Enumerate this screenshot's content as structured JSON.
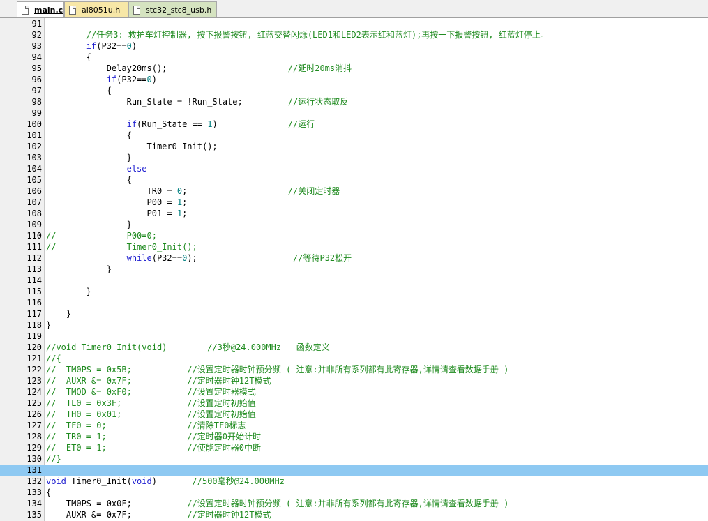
{
  "tabs": [
    {
      "label": "main.c",
      "active": true,
      "color": "#ffffff"
    },
    {
      "label": "ai8051u.h",
      "active": false,
      "color": "#f7e7a7"
    },
    {
      "label": "stc32_stc8_usb.h",
      "active": false,
      "color": "#d5e3c0"
    }
  ],
  "colors": {
    "keyword": "#1f1fd0",
    "number": "#008080",
    "comment": "#1e8a1e",
    "highlight": "#8ec9f2"
  },
  "editor": {
    "highlighted_line": "131",
    "lines": [
      {
        "n": "91",
        "tokens": []
      },
      {
        "n": "92",
        "tokens": [
          {
            "t": "        "
          },
          {
            "t": "//任务3: 救护车灯控制器, 按下报警按钮, 红蓝交替闪烁(LED1和LED2表示红和蓝灯);再按一下报警按钮, 红蓝灯停止。",
            "c": "cm"
          }
        ]
      },
      {
        "n": "93",
        "tokens": [
          {
            "t": "        "
          },
          {
            "t": "if",
            "c": "kw"
          },
          {
            "t": "(P32=="
          },
          {
            "t": "0",
            "c": "num"
          },
          {
            "t": ")"
          }
        ]
      },
      {
        "n": "94",
        "tokens": [
          {
            "t": "        {"
          }
        ]
      },
      {
        "n": "95",
        "tokens": [
          {
            "t": "            Delay20ms();                        "
          },
          {
            "t": "//延时20ms消抖",
            "c": "cm"
          }
        ]
      },
      {
        "n": "96",
        "tokens": [
          {
            "t": "            "
          },
          {
            "t": "if",
            "c": "kw"
          },
          {
            "t": "(P32=="
          },
          {
            "t": "0",
            "c": "num"
          },
          {
            "t": ")"
          }
        ]
      },
      {
        "n": "97",
        "tokens": [
          {
            "t": "            {"
          }
        ]
      },
      {
        "n": "98",
        "tokens": [
          {
            "t": "                Run_State = !Run_State;         "
          },
          {
            "t": "//运行状态取反",
            "c": "cm"
          }
        ]
      },
      {
        "n": "99",
        "tokens": []
      },
      {
        "n": "100",
        "tokens": [
          {
            "t": "                "
          },
          {
            "t": "if",
            "c": "kw"
          },
          {
            "t": "(Run_State == "
          },
          {
            "t": "1",
            "c": "num"
          },
          {
            "t": ")              "
          },
          {
            "t": "//运行",
            "c": "cm"
          }
        ]
      },
      {
        "n": "101",
        "tokens": [
          {
            "t": "                {"
          }
        ]
      },
      {
        "n": "102",
        "tokens": [
          {
            "t": "                    Timer0_Init();"
          }
        ]
      },
      {
        "n": "103",
        "tokens": [
          {
            "t": "                }"
          }
        ]
      },
      {
        "n": "104",
        "tokens": [
          {
            "t": "                "
          },
          {
            "t": "else",
            "c": "kw"
          }
        ]
      },
      {
        "n": "105",
        "tokens": [
          {
            "t": "                {"
          }
        ]
      },
      {
        "n": "106",
        "tokens": [
          {
            "t": "                    TR0 = "
          },
          {
            "t": "0",
            "c": "num"
          },
          {
            "t": ";                    "
          },
          {
            "t": "//关闭定时器",
            "c": "cm"
          }
        ]
      },
      {
        "n": "107",
        "tokens": [
          {
            "t": "                    P00 = "
          },
          {
            "t": "1",
            "c": "num"
          },
          {
            "t": ";"
          }
        ]
      },
      {
        "n": "108",
        "tokens": [
          {
            "t": "                    P01 = "
          },
          {
            "t": "1",
            "c": "num"
          },
          {
            "t": ";"
          }
        ]
      },
      {
        "n": "109",
        "tokens": [
          {
            "t": "                }"
          }
        ]
      },
      {
        "n": "110",
        "tokens": [
          {
            "t": "//              P00=0;",
            "c": "cm"
          }
        ]
      },
      {
        "n": "111",
        "tokens": [
          {
            "t": "//              Timer0_Init();",
            "c": "cm"
          }
        ]
      },
      {
        "n": "112",
        "tokens": [
          {
            "t": "                "
          },
          {
            "t": "while",
            "c": "kw"
          },
          {
            "t": "(P32=="
          },
          {
            "t": "0",
            "c": "num"
          },
          {
            "t": ");                   "
          },
          {
            "t": "//等待P32松开",
            "c": "cm"
          }
        ]
      },
      {
        "n": "113",
        "tokens": [
          {
            "t": "            }"
          }
        ]
      },
      {
        "n": "114",
        "tokens": []
      },
      {
        "n": "115",
        "tokens": [
          {
            "t": "        }"
          }
        ]
      },
      {
        "n": "116",
        "tokens": []
      },
      {
        "n": "117",
        "tokens": [
          {
            "t": "    }"
          }
        ]
      },
      {
        "n": "118",
        "tokens": [
          {
            "t": "}"
          }
        ]
      },
      {
        "n": "119",
        "tokens": []
      },
      {
        "n": "120",
        "tokens": [
          {
            "t": "//void Timer0_Init(void)        //3秒@24.000MHz   函数定义",
            "c": "cm"
          }
        ]
      },
      {
        "n": "121",
        "tokens": [
          {
            "t": "//{",
            "c": "cm"
          }
        ]
      },
      {
        "n": "122",
        "tokens": [
          {
            "t": "//  TM0PS = 0x5B;           //设置定时器时钟预分频 ( 注意:并非所有系列都有此寄存器,详情请查看数据手册 )",
            "c": "cm"
          }
        ]
      },
      {
        "n": "123",
        "tokens": [
          {
            "t": "//  AUXR &= 0x7F;           //定时器时钟12T模式",
            "c": "cm"
          }
        ]
      },
      {
        "n": "124",
        "tokens": [
          {
            "t": "//  TMOD &= 0xF0;           //设置定时器模式",
            "c": "cm"
          }
        ]
      },
      {
        "n": "125",
        "tokens": [
          {
            "t": "//  TL0 = 0x3F;             //设置定时初始值",
            "c": "cm"
          }
        ]
      },
      {
        "n": "126",
        "tokens": [
          {
            "t": "//  TH0 = 0x01;             //设置定时初始值",
            "c": "cm"
          }
        ]
      },
      {
        "n": "127",
        "tokens": [
          {
            "t": "//  TF0 = 0;                //清除TF0标志",
            "c": "cm"
          }
        ]
      },
      {
        "n": "128",
        "tokens": [
          {
            "t": "//  TR0 = 1;                //定时器0开始计时",
            "c": "cm"
          }
        ]
      },
      {
        "n": "129",
        "tokens": [
          {
            "t": "//  ET0 = 1;                //使能定时器0中断",
            "c": "cm"
          }
        ]
      },
      {
        "n": "130",
        "tokens": [
          {
            "t": "//}",
            "c": "cm"
          }
        ]
      },
      {
        "n": "131",
        "tokens": []
      },
      {
        "n": "132",
        "tokens": [
          {
            "t": "void",
            "c": "kw"
          },
          {
            "t": " Timer0_Init("
          },
          {
            "t": "void",
            "c": "kw"
          },
          {
            "t": ")       "
          },
          {
            "t": "//500毫秒@24.000MHz",
            "c": "cm"
          }
        ]
      },
      {
        "n": "133",
        "tokens": [
          {
            "t": "{"
          }
        ]
      },
      {
        "n": "134",
        "tokens": [
          {
            "t": "    TM0PS = 0x0F;           "
          },
          {
            "t": "//设置定时器时钟预分频 ( 注意:并非所有系列都有此寄存器,详情请查看数据手册 )",
            "c": "cm"
          }
        ]
      },
      {
        "n": "135",
        "tokens": [
          {
            "t": "    AUXR &= 0x7F;           "
          },
          {
            "t": "//定时器时钟12T模式",
            "c": "cm"
          }
        ]
      }
    ]
  }
}
